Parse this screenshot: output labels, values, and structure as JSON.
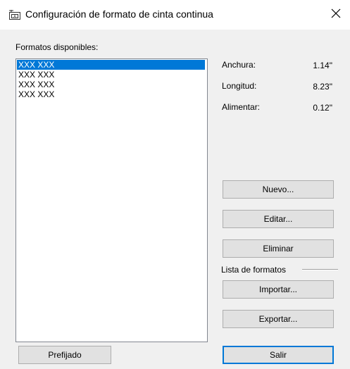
{
  "window": {
    "title": "Configuración de formato de cinta continua",
    "title_icon": "tape-format-icon",
    "close_icon": "close-icon"
  },
  "formats": {
    "label": "Formatos disponibles:",
    "items": [
      {
        "label": "XXX XXX",
        "selected": true
      },
      {
        "label": "XXX XXX",
        "selected": false
      },
      {
        "label": "XXX XXX",
        "selected": false
      },
      {
        "label": "XXX XXX",
        "selected": false
      }
    ]
  },
  "details": {
    "width_label": "Anchura:",
    "width_value": "1.14\"",
    "length_label": "Longitud:",
    "length_value": "8.23\"",
    "feed_label": "Alimentar:",
    "feed_value": "0.12\""
  },
  "buttons": {
    "new": "Nuevo...",
    "edit": "Editar...",
    "delete": "Eliminar",
    "import": "Importar...",
    "export": "Exportar...",
    "preset": "Prefijado",
    "exit": "Salir"
  },
  "format_list_group": {
    "label": "Lista de formatos"
  },
  "colors": {
    "selection": "#0078d7",
    "default_button_border": "#0078d7"
  }
}
